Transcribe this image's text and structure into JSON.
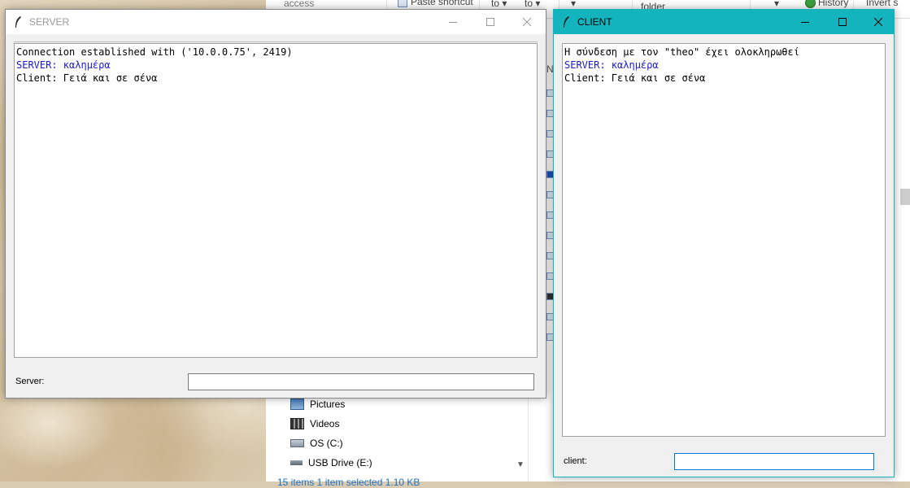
{
  "explorer": {
    "ribbon": {
      "access_label": "access",
      "paste_shortcut_label": "Paste shortcut",
      "to_label_1": "to ▾",
      "to_label_2": "to ▾",
      "folder_label": "folder",
      "history_label": "History",
      "invert_label": "Invert s"
    },
    "nav_letter": "N",
    "tree": [
      {
        "label": "Pictures",
        "icon": "pictures-icon"
      },
      {
        "label": "Videos",
        "icon": "videos-icon"
      },
      {
        "label": "OS (C:)",
        "icon": "drive-icon"
      },
      {
        "label": "USB Drive (E:)",
        "icon": "usb-drive-icon"
      }
    ],
    "status": "15 items    1 item selected  1.10 KB"
  },
  "server_window": {
    "title": "SERVER",
    "lines": [
      {
        "text": "Connection established with ('10.0.0.75', 2419)",
        "kind": "normal"
      },
      {
        "text": "SERVER: καλημέρα",
        "kind": "server"
      },
      {
        "text": "Client: Γειά και σε σένα",
        "kind": "normal"
      }
    ],
    "entry_label": "Server:",
    "entry_value": ""
  },
  "client_window": {
    "title": "CLIENT",
    "lines": [
      {
        "text": "Η σύνδεση με τον \"theo\" έχει ολοκληρωθεί",
        "kind": "normal"
      },
      {
        "text": "SERVER: καλημέρα",
        "kind": "server"
      },
      {
        "text": "Client: Γειά και σε σένα",
        "kind": "normal"
      }
    ],
    "entry_label": "client:",
    "entry_value": ""
  },
  "colors": {
    "server_message": "#1a1ad0",
    "client_titlebar": "#14b4bf"
  }
}
